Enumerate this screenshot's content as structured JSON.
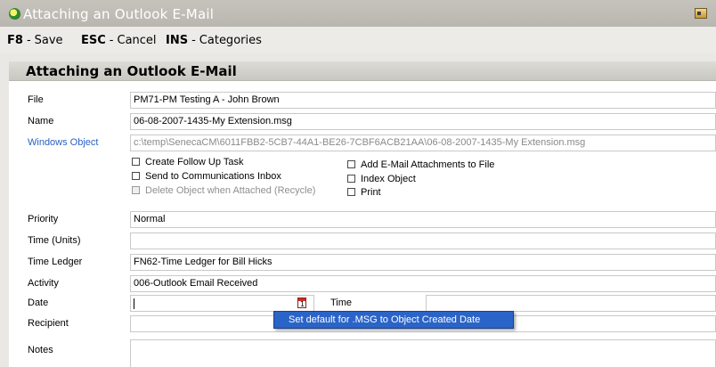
{
  "window": {
    "title": "Attaching an Outlook E-Mail"
  },
  "toolbar": {
    "items": [
      {
        "key": "F8",
        "label": "Save"
      },
      {
        "key": "ESC",
        "label": "Cancel"
      },
      {
        "key": "INS",
        "label": "Categories"
      }
    ]
  },
  "section": {
    "title": "Attaching an Outlook E-Mail"
  },
  "fields": {
    "file": {
      "label": "File",
      "value": "PM71-PM Testing A - John Brown"
    },
    "name": {
      "label": "Name",
      "value": "06-08-2007-1435-My Extension.msg"
    },
    "windows_object": {
      "label": "Windows Object",
      "value": "c:\\temp\\SenecaCM\\6011FBB2-5CB7-44A1-BE26-7CBF6ACB21AA\\06-08-2007-1435-My Extension.msg"
    },
    "priority": {
      "label": "Priority",
      "value": "Normal"
    },
    "time_units": {
      "label": "Time (Units)",
      "value": ""
    },
    "time_ledger": {
      "label": "Time Ledger",
      "value": "FN62-Time Ledger for Bill Hicks"
    },
    "activity": {
      "label": "Activity",
      "value": "006-Outlook Email Received"
    },
    "date": {
      "label": "Date",
      "value": ""
    },
    "time": {
      "label": "Time",
      "value": ""
    },
    "recipient": {
      "label": "Recipient",
      "value": ""
    },
    "notes": {
      "label": "Notes",
      "value": ""
    }
  },
  "checkboxes": {
    "create_follow_up": {
      "label": "Create Follow Up Task",
      "checked": false
    },
    "send_to_inbox": {
      "label": "Send to Communications Inbox",
      "checked": false
    },
    "delete_object": {
      "label": "Delete Object when Attached (Recycle)",
      "checked": false,
      "disabled": true
    },
    "add_attachments": {
      "label": "Add E-Mail Attachments to File",
      "checked": false
    },
    "index_object": {
      "label": "Index Object",
      "checked": false
    },
    "print": {
      "label": "Print",
      "checked": false
    }
  },
  "context_menu": {
    "item": "Set default for .MSG to Object Created Date"
  },
  "colors": {
    "link": "#2a62c0",
    "menu_highlight": "#2b64c8",
    "titlebar": "#bfbcb6"
  },
  "icons": {
    "app": "app-logo-icon",
    "window": "window-menu-icon",
    "calendar": "calendar-icon"
  }
}
